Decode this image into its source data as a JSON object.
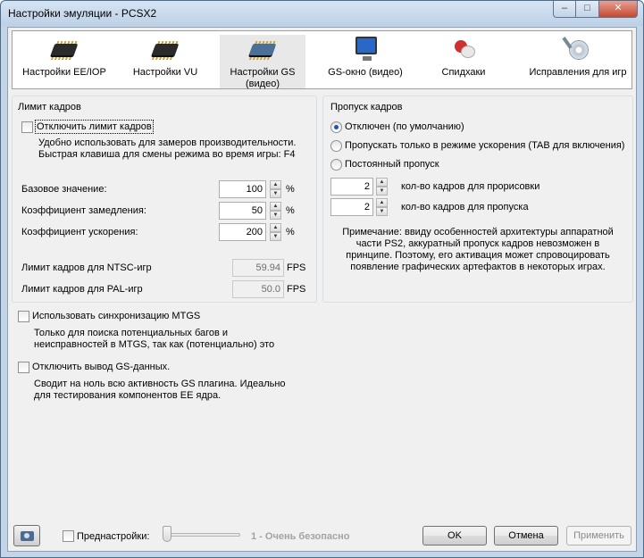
{
  "window": {
    "title": "Настройки эмуляции - PCSX2",
    "min_label": "–",
    "max_label": "□",
    "close_label": "✕"
  },
  "toolbar": {
    "items": [
      {
        "label": "Настройки EE/IOP",
        "icon": "chip-icon"
      },
      {
        "label": "Настройки VU",
        "icon": "chip-icon"
      },
      {
        "label": "Настройки GS",
        "label2": "(видео)",
        "icon": "gs-chip-icon",
        "selected": true
      },
      {
        "label": "GS-окно (видео)",
        "icon": "monitor-icon"
      },
      {
        "label": "Спидхаки",
        "icon": "pills-icon"
      },
      {
        "label": "Исправления для игр",
        "icon": "disc-wrench-icon"
      }
    ]
  },
  "frame_limit": {
    "group_title": "Лимит кадров",
    "disable_label": "Отключить лимит кадров",
    "disable_checked": false,
    "desc_line1": "Удобно использовать для замеров производительности.",
    "desc_line2": "Быстрая клавиша для смены режима во время игры: F4",
    "base_label": "Базовое значение:",
    "base_value": "100",
    "slow_label": "Коэффициент замедления:",
    "slow_value": "50",
    "turbo_label": "Коэффициент ускорения:",
    "turbo_value": "200",
    "percent": "%",
    "ntsc_label": "Лимит кадров для NTSC-игр",
    "ntsc_value": "59.94",
    "pal_label": "Лимит кадров для PAL-игр",
    "pal_value": "50.0",
    "fps": "FPS"
  },
  "frame_skip": {
    "group_title": "Пропуск кадров",
    "radio1": "Отключен (по умолчанию)",
    "radio2": "Пропускать только в режиме ускорения (TAB для включения)",
    "radio3": "Постоянный пропуск",
    "selected_option": "radio1",
    "draw_value": "2",
    "draw_label": "кол-во кадров для прорисовки",
    "skip_value": "2",
    "skip_label": "кол-во кадров для пропуска",
    "note_line1": "Примечание: ввиду особенностей архитектуры аппаратной",
    "note_line2": "части PS2, аккуратный пропуск кадров невозможен в",
    "note_line3": "принципе. Поэтому, его активация может спровоцировать",
    "note_line4": "появление графических артефактов в некоторых играх."
  },
  "mtgs": {
    "label": "Использовать синхронизацию MTGS",
    "checked": false,
    "desc_line1": "Только для поиска потенциальных багов и",
    "desc_line2": "неисправностей в MTGS, так как (потенциально) это"
  },
  "gs_output": {
    "label": "Отключить вывод GS-данных.",
    "checked": false,
    "desc_line1": "Сводит на ноль всю активность GS плагина. Идеально",
    "desc_line2": "для тестирования компонентов EE ядра."
  },
  "footer": {
    "presets_label": "Преднастройки:",
    "presets_checked": false,
    "preset_level": 1,
    "preset_text": "1 - Очень безопасно",
    "ok_label": "OK",
    "cancel_label": "Отмена",
    "apply_label": "Применить"
  }
}
